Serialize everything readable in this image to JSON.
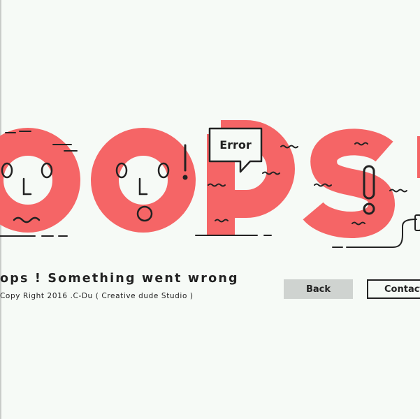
{
  "hero": {
    "word": "OOPS!",
    "bubble_text": "Error"
  },
  "message": {
    "headline": "ops ! Something went wrong",
    "copyright": "Copy Right 2016 .C-Du ( Creative dude Studio )"
  },
  "buttons": {
    "back_label": "Back",
    "contact_label": "Contact"
  },
  "colors": {
    "background": "#f6faf6",
    "accent": "#f56566",
    "ink": "#222222",
    "button_gray": "#cfd3d0"
  }
}
